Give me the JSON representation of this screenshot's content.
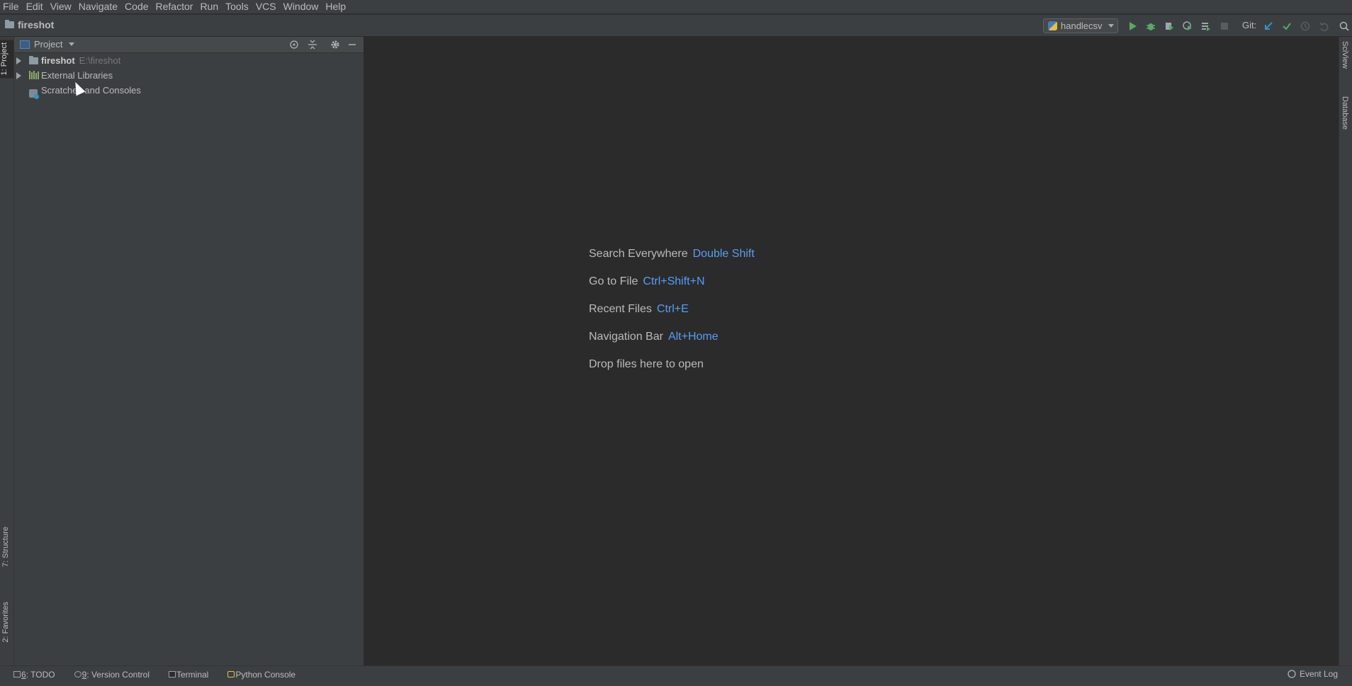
{
  "menu": [
    "File",
    "Edit",
    "View",
    "Navigate",
    "Code",
    "Refactor",
    "Run",
    "Tools",
    "VCS",
    "Window",
    "Help"
  ],
  "navbar": {
    "breadcrumb": "fireshot",
    "run_config": "handlecsv",
    "git_label": "Git:"
  },
  "left_tabs": {
    "project": "1: Project",
    "structure": "7: Structure",
    "favorites": "2: Favorites"
  },
  "right_tabs": {
    "sciview": "SciView",
    "database": "Database"
  },
  "project_panel": {
    "title": "Project",
    "tree": [
      {
        "label": "fireshot",
        "path": "E:\\fireshot",
        "expandable": true
      },
      {
        "label": "External Libraries",
        "path": "",
        "expandable": true
      },
      {
        "label": "Scratches and Consoles",
        "path": "",
        "expandable": false
      }
    ]
  },
  "editor_hints": [
    {
      "text": "Search Everywhere",
      "key": "Double Shift"
    },
    {
      "text": "Go to File",
      "key": "Ctrl+Shift+N"
    },
    {
      "text": "Recent Files",
      "key": "Ctrl+E"
    },
    {
      "text": "Navigation Bar",
      "key": "Alt+Home"
    },
    {
      "text": "Drop files here to open",
      "key": ""
    }
  ],
  "bottom_tabs": {
    "todo": {
      "num": "6",
      "label": ": TODO"
    },
    "vcs": {
      "num": "9",
      "label": ": Version Control"
    },
    "terminal": "Terminal",
    "python_console": "Python Console"
  },
  "event_log": "Event Log",
  "colors": {
    "accent_key": "#589df6",
    "run_green": "#59a869",
    "panel_bg": "#3c3f41",
    "editor_bg": "#2b2b2b"
  }
}
